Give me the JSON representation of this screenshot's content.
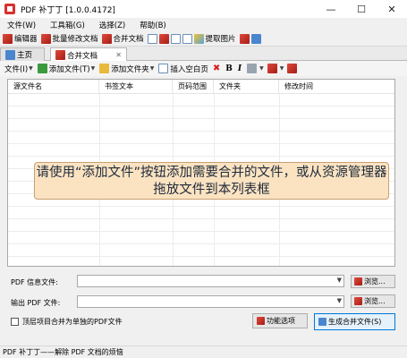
{
  "window": {
    "title": "PDF 补丁丁 [1.0.0.4172]",
    "minimize": "—",
    "maximize": "☐",
    "close": "✕"
  },
  "menu": [
    "文件(W)",
    "工具箱(G)",
    "选择(Z)",
    "帮助(B)"
  ],
  "toolbar": {
    "editor": "编辑器",
    "batch_modify": "批量修改文档",
    "merge_doc": "合并文档",
    "extract_images": "提取图片"
  },
  "tabs": {
    "home": "主页",
    "merge": "合并文档",
    "close": "✕"
  },
  "subtoolbar": {
    "file_menu": "文件(I)",
    "add_file": "添加文件(T)",
    "add_folder": "添加文件夹",
    "insert_blank": "插入空白页",
    "bold": "B",
    "italic": "I"
  },
  "list": {
    "columns": [
      "源文件名",
      "书签文本",
      "页码范围",
      "文件夹",
      "修改时间"
    ],
    "hint": "请使用“添加文件”按钮添加需要合并的文件，或从资源管理器拖放文件到本列表框"
  },
  "form": {
    "pdf_info_label": "PDF 信息文件:",
    "output_label": "输出 PDF 文件:",
    "browse": "浏览...",
    "top_level_checkbox": "顶层项目合并为单独的PDF文件",
    "options_button": "功能选项",
    "generate_button": "生成合并文件(S)"
  },
  "status": "PDF 补丁丁——解除 PDF 文档的烦恼"
}
